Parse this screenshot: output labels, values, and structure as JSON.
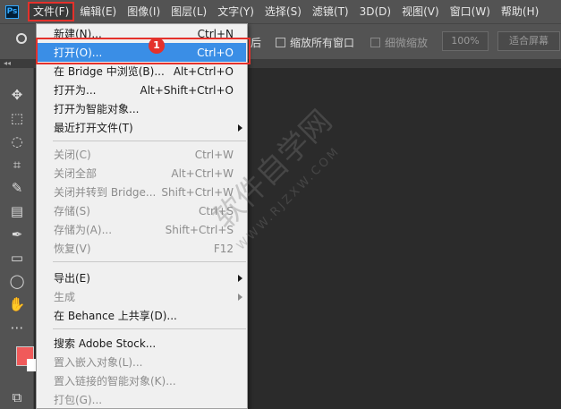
{
  "app_logo": "Ps",
  "menubar": {
    "items": [
      "文件(F)",
      "编辑(E)",
      "图像(I)",
      "图层(L)",
      "文字(Y)",
      "选择(S)",
      "滤镜(T)",
      "3D(D)",
      "视图(V)",
      "窗口(W)",
      "帮助(H)"
    ]
  },
  "options": {
    "partial_char": "后",
    "resize_all_windows": "缩放所有窗口",
    "scrubby_zoom": "细微缩放",
    "zoom_value": "100%",
    "fit_screen": "适合屏幕",
    "tab_arrows": "◂◂"
  },
  "file_menu": {
    "new": {
      "label": "新建(N)...",
      "shortcut": "Ctrl+N"
    },
    "open": {
      "label": "打开(O)...",
      "shortcut": "Ctrl+O"
    },
    "bridge": {
      "label": "在 Bridge 中浏览(B)...",
      "shortcut": "Alt+Ctrl+O"
    },
    "open_as": {
      "label": "打开为...",
      "shortcut": "Alt+Shift+Ctrl+O"
    },
    "open_smart": {
      "label": "打开为智能对象..."
    },
    "recent": {
      "label": "最近打开文件(T)"
    },
    "close": {
      "label": "关闭(C)",
      "shortcut": "Ctrl+W"
    },
    "close_all": {
      "label": "关闭全部",
      "shortcut": "Alt+Ctrl+W"
    },
    "close_bridge": {
      "label": "关闭并转到 Bridge...",
      "shortcut": "Shift+Ctrl+W"
    },
    "save": {
      "label": "存储(S)",
      "shortcut": "Ctrl+S"
    },
    "save_as": {
      "label": "存储为(A)...",
      "shortcut": "Shift+Ctrl+S"
    },
    "revert": {
      "label": "恢复(V)",
      "shortcut": "F12"
    },
    "export": {
      "label": "导出(E)"
    },
    "generate": {
      "label": "生成"
    },
    "behance": {
      "label": "在 Behance 上共享(D)..."
    },
    "stock": {
      "label": "搜索 Adobe Stock..."
    },
    "place_embedded": {
      "label": "置入嵌入对象(L)..."
    },
    "place_linked": {
      "label": "置入链接的智能对象(K)..."
    },
    "package": {
      "label": "打包(G)..."
    }
  },
  "annotation_badge": "1",
  "watermark": {
    "main": "软件自学网",
    "sub": "WWW.RJZXW.COM"
  },
  "colors": {
    "accent_red": "#e4312b",
    "highlight_blue": "#3a8ee6",
    "foreground_swatch": "#f05a5a"
  }
}
